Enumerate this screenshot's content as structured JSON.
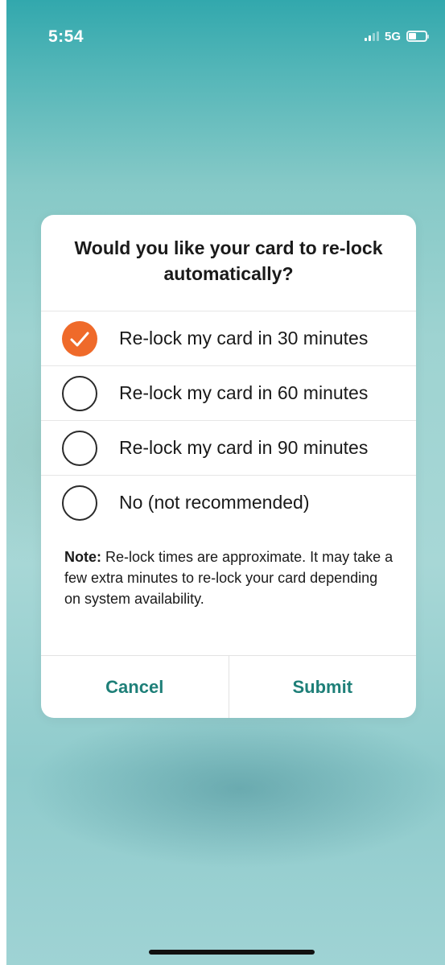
{
  "status_bar": {
    "time": "5:54",
    "network": "5G",
    "battery_level": 0.45
  },
  "dialog": {
    "title": "Would you like your card to re-lock automatically?",
    "options": [
      {
        "label": "Re-lock my card in 30 minutes",
        "selected": true
      },
      {
        "label": "Re-lock my card in 60 minutes",
        "selected": false
      },
      {
        "label": "Re-lock my card in 90 minutes",
        "selected": false
      },
      {
        "label": "No (not recommended)",
        "selected": false
      }
    ],
    "note_prefix": "Note:",
    "note_text": "Re-lock times are approximate. It may take a few extra minutes to re-lock your card depending on system availability.",
    "cancel_label": "Cancel",
    "submit_label": "Submit"
  },
  "colors": {
    "accent": "#ef6a2a",
    "button_text": "#1e7f78",
    "background_teal": "#86c9c7"
  },
  "icons": {
    "selected_radio": "check-icon",
    "signal": "signal-icon",
    "battery": "battery-icon"
  }
}
